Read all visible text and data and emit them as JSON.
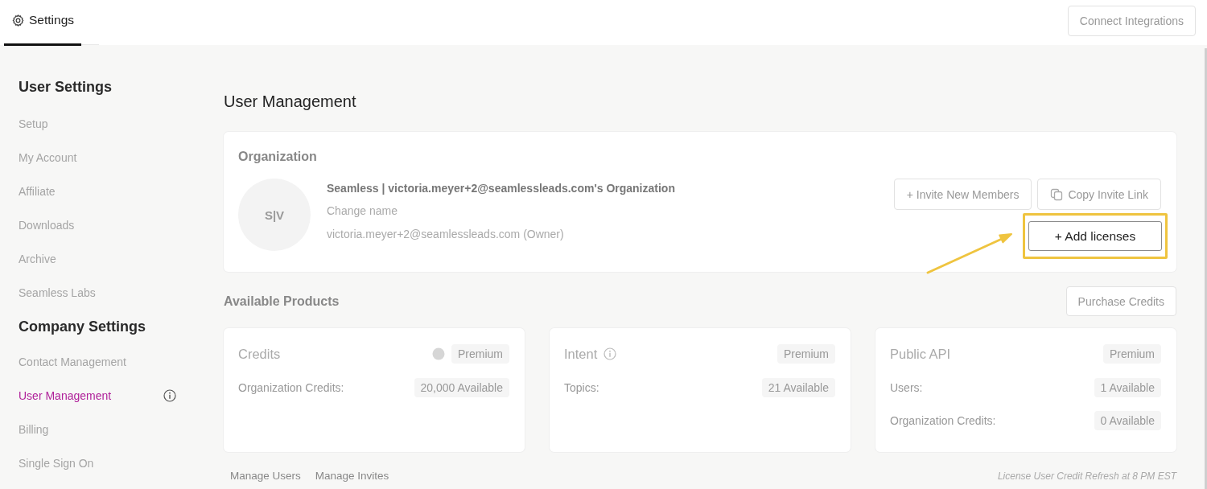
{
  "header": {
    "tabs": [
      {
        "label": "Settings",
        "selected": true
      }
    ],
    "button": "Connect Integrations"
  },
  "sidebar": {
    "sections": [
      {
        "title": "User Settings",
        "items": [
          {
            "label": "Setup",
            "selected": false
          },
          {
            "label": "My Account",
            "selected": false
          },
          {
            "label": "Affiliate",
            "selected": false
          },
          {
            "label": "Downloads",
            "selected": false
          },
          {
            "label": "Archive",
            "selected": false
          },
          {
            "label": "Seamless Labs",
            "selected": false
          }
        ]
      },
      {
        "title": "Company Settings",
        "items": [
          {
            "label": "Contact Management",
            "selected": false
          },
          {
            "label": "User Management",
            "selected": true
          },
          {
            "label": "Billing",
            "selected": false
          },
          {
            "label": "Single Sign On",
            "selected": false
          }
        ]
      }
    ]
  },
  "main": {
    "title": "User Management",
    "organization": {
      "heading": "Organization",
      "avatar": "S|V",
      "name": "Seamless | victoria.meyer+2@seamlessleads.com's Organization",
      "rename_link": "Change name",
      "owner": "victoria.meyer+2@seamlessleads.com (Owner)",
      "actions": [
        {
          "label": "+ Invite New Members",
          "highlighted": false
        },
        {
          "label": "Copy Invite Link",
          "highlighted": false
        },
        {
          "label": "+ Add licenses",
          "highlighted": true
        }
      ]
    },
    "products": {
      "title": "Available Products",
      "button": "Purchase Credits",
      "cards": [
        {
          "title": "Credits",
          "badge": "Premium",
          "rows": [
            {
              "label": "Organization Credits:",
              "value": "20,000 Available"
            }
          ]
        },
        {
          "title": "Intent",
          "badge": "Premium",
          "rows": [
            {
              "label": "Topics:",
              "value": "21 Available"
            }
          ]
        },
        {
          "title": "Public API",
          "badge": "Premium",
          "rows": [
            {
              "label": "Users:",
              "value": "1 Available"
            },
            {
              "label": "Organization Credits:",
              "value": "0 Available"
            }
          ]
        }
      ]
    },
    "footer": {
      "links": [
        "Manage Users",
        "Manage Invites"
      ],
      "note": "License User Credit Refresh at 8 PM EST"
    }
  }
}
